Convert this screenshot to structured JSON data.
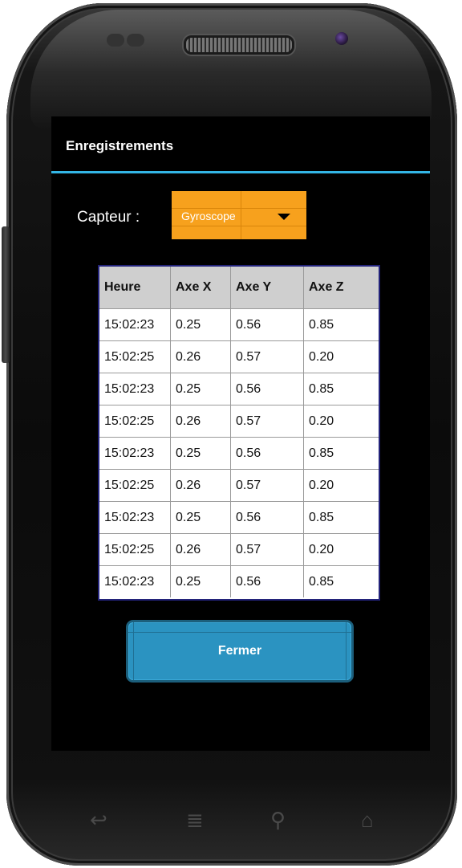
{
  "app": {
    "title": "Enregistrements"
  },
  "sensor": {
    "label": "Capteur :",
    "selected": "Gyroscope"
  },
  "table": {
    "headers": [
      "Heure",
      "Axe X",
      "Axe Y",
      "Axe Z"
    ],
    "rows": [
      [
        "15:02:23",
        "0.25",
        "0.56",
        "0.85"
      ],
      [
        "15:02:25",
        "0.26",
        "0.57",
        "0.20"
      ],
      [
        "15:02:23",
        "0.25",
        "0.56",
        "0.85"
      ],
      [
        "15:02:25",
        "0.26",
        "0.57",
        "0.20"
      ],
      [
        "15:02:23",
        "0.25",
        "0.56",
        "0.85"
      ],
      [
        "15:02:25",
        "0.26",
        "0.57",
        "0.20"
      ],
      [
        "15:02:23",
        "0.25",
        "0.56",
        "0.85"
      ],
      [
        "15:02:25",
        "0.26",
        "0.57",
        "0.20"
      ],
      [
        "15:02:23",
        "0.25",
        "0.56",
        "0.85"
      ]
    ]
  },
  "button": {
    "close_label": "Fermer"
  },
  "nav": {
    "back_icon": "↩",
    "menu_icon": "≣",
    "search_icon": "⚲",
    "home_icon": "⌂"
  },
  "colors": {
    "accent": "#33b5e5",
    "dropdown": "#f7a11d",
    "button": "#2b93c1",
    "header_row": "#cfcfcf"
  }
}
